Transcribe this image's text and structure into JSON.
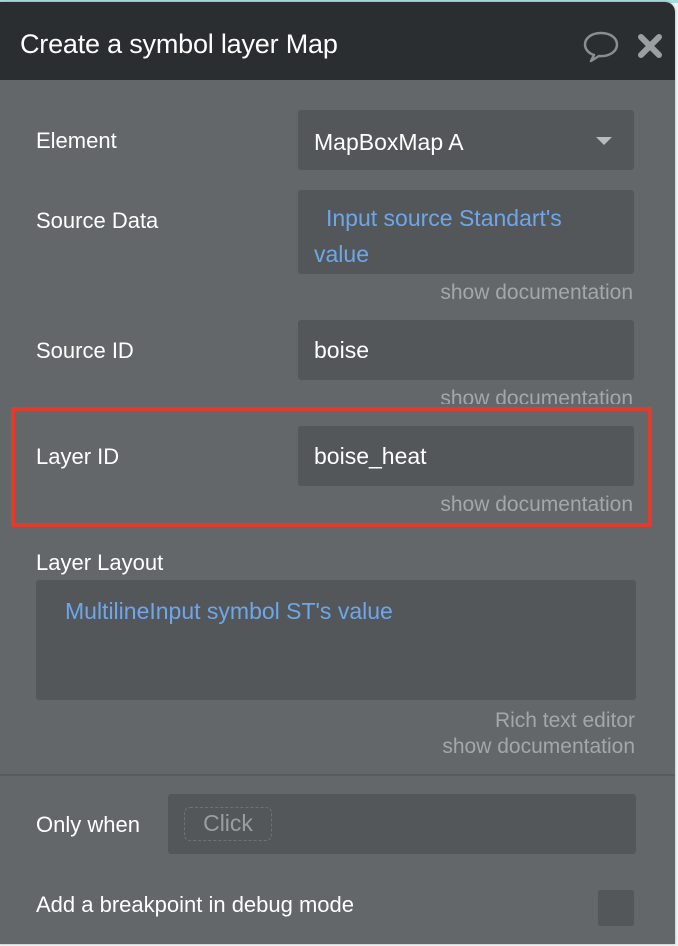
{
  "window": {
    "title": "Create a symbol layer Map",
    "comment_icon": "speech-bubble-icon",
    "close_icon": "close-x-icon"
  },
  "fields": {
    "element": {
      "label": "Element",
      "value": "MapBoxMap A",
      "icon": "chevron-down-icon"
    },
    "source_data": {
      "label": "Source Data",
      "value": "Input source Standart's value",
      "value_line1": "Input source Standart's",
      "value_line2": "value",
      "doc_link": "show documentation"
    },
    "source_id": {
      "label": "Source ID",
      "value": "boise",
      "doc_link": "show documentation"
    },
    "layer_id": {
      "label": "Layer ID",
      "value": "boise_heat",
      "doc_link": "show documentation"
    },
    "layer_layout": {
      "label": "Layer Layout",
      "value": "MultilineInput symbol ST's value",
      "rich_text_link": "Rich text editor",
      "doc_link": "show documentation"
    }
  },
  "conditions": {
    "only_when": {
      "label": "Only when",
      "placeholder_chip": "Click"
    },
    "breakpoint": {
      "label": "Add a breakpoint in debug mode",
      "checked": false
    }
  },
  "colors": {
    "header_bg": "#2a2e31",
    "panel_bg": "#636769",
    "field_bg": "#53575a",
    "dynamic_text": "#6fa6e8",
    "highlight": "#e23b2e"
  }
}
